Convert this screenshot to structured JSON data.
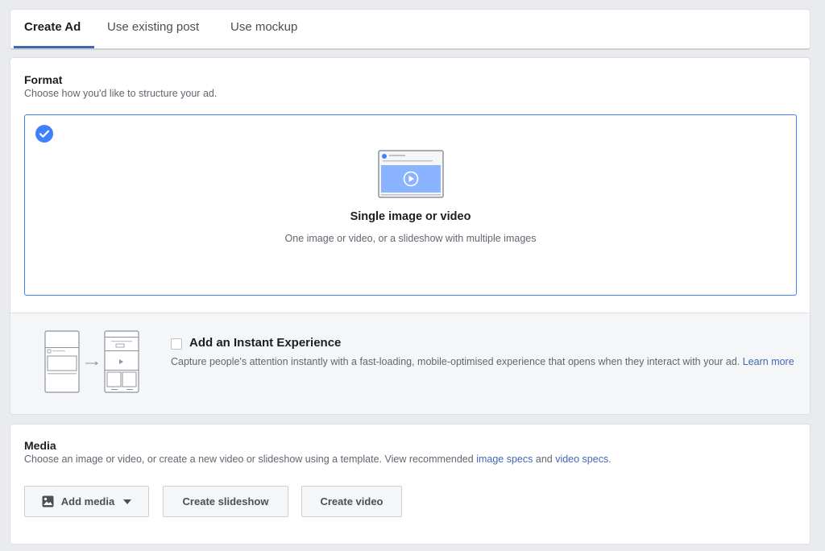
{
  "tabs": [
    {
      "label": "Create Ad",
      "active": true
    },
    {
      "label": "Use existing post",
      "active": false
    },
    {
      "label": "Use mockup",
      "active": false
    }
  ],
  "format": {
    "title": "Format",
    "subtitle": "Choose how you'd like to structure your ad.",
    "option": {
      "label": "Single image or video",
      "description": "One image or video, or a slideshow with multiple images",
      "selected": true
    },
    "instant_experience": {
      "title": "Add an Instant Experience",
      "description": "Capture people's attention instantly with a fast-loading, mobile-optimised experience that opens when they interact with your ad.",
      "link": "Learn more",
      "checked": false
    }
  },
  "media": {
    "title": "Media",
    "subtitle_prefix": "Choose an image or video, or create a new video or slideshow using a template. View recommended ",
    "image_specs_link": "image specs",
    "and_text": " and ",
    "video_specs_link": "video specs",
    "period": ".",
    "buttons": {
      "add_media": "Add media",
      "create_slideshow": "Create slideshow",
      "create_video": "Create video"
    }
  },
  "colors": {
    "accent": "#4267b2",
    "selected_border": "#4080ff",
    "check": "#4080ff"
  },
  "icons": {
    "check": "check-circle-icon",
    "image": "image-icon",
    "dropdown": "caret-down-icon"
  }
}
